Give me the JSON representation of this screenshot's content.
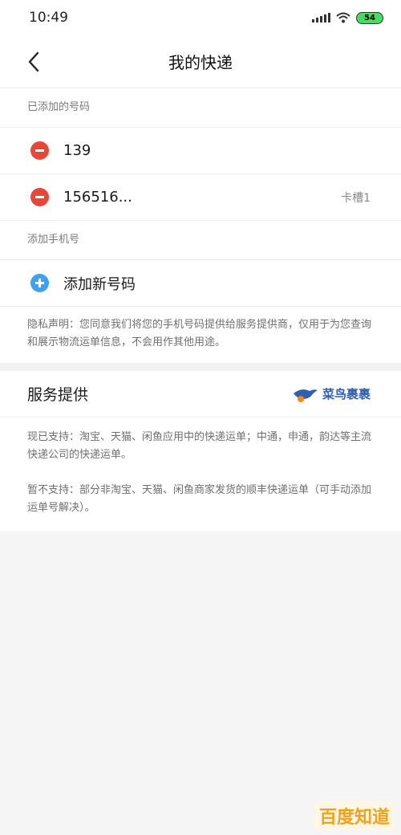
{
  "status_bar": {
    "time": "10:49",
    "battery": "54"
  },
  "nav": {
    "title": "我的快递"
  },
  "added_section": {
    "label": "已添加的号码",
    "numbers": [
      {
        "number": "139",
        "slot": ""
      },
      {
        "number": "156516...",
        "slot": "卡槽1"
      }
    ]
  },
  "add_section": {
    "label": "添加手机号",
    "add_label": "添加新号码"
  },
  "privacy": {
    "text": "隐私声明：您同意我们将您的手机号码提供给服务提供商，仅用于为您查询和展示物流运单信息，不会用作其他用途。"
  },
  "service": {
    "title": "服务提供",
    "provider": "菜鸟裹裹",
    "supported": "现已支持：淘宝、天猫、闲鱼应用中的快递运单；中通，申通，韵达等主流快递公司的快递运单。",
    "unsupported": "暂不支持：部分非淘宝、天猫、闲鱼商家发货的顺丰快递运单（可手动添加运单号解决）。"
  },
  "watermark": {
    "text": "百度知道"
  },
  "colors": {
    "minus": "#e8463b",
    "plus": "#3ea2f0",
    "provider": "#2f5fb3"
  }
}
